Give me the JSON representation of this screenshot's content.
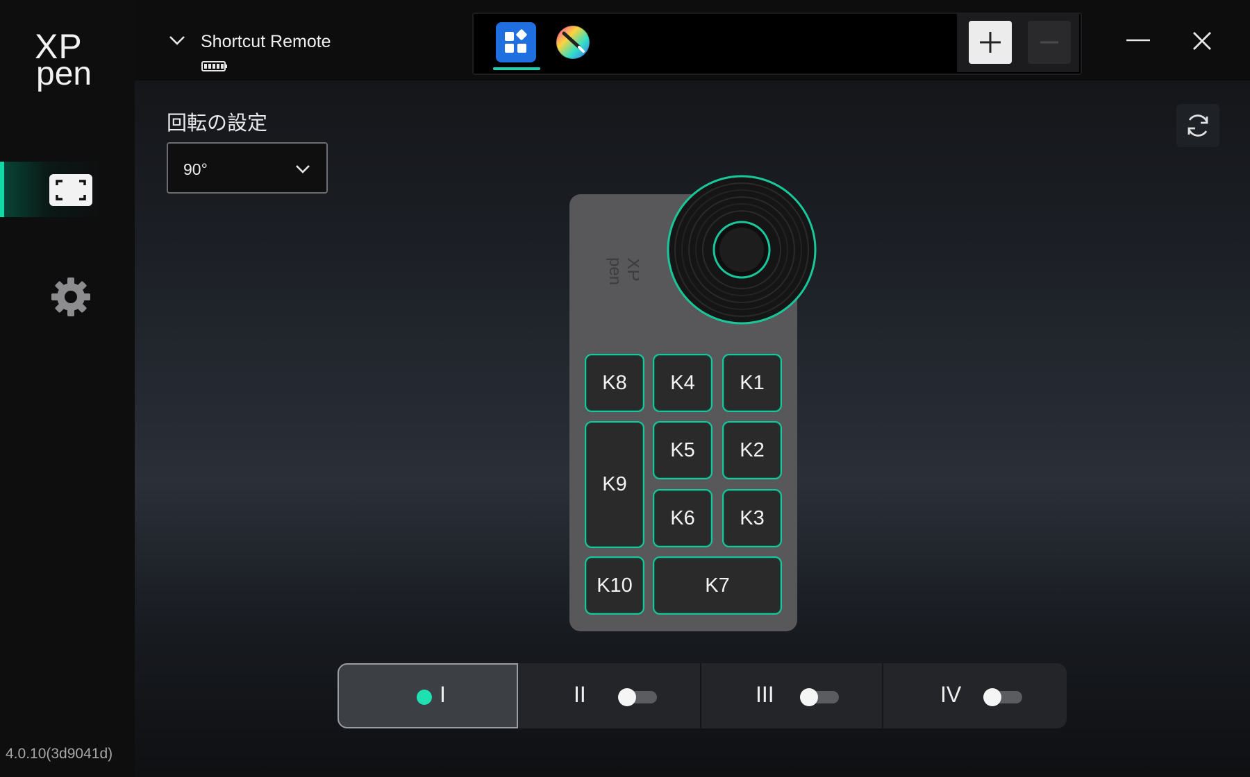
{
  "app": {
    "version": "4.0.10(3d9041d)"
  },
  "logo": {
    "line1": "XP",
    "line2": "pen"
  },
  "sidebar": {
    "items": [
      {
        "icon": "device-frame-icon",
        "active": true
      },
      {
        "icon": "gear-icon",
        "active": false
      }
    ]
  },
  "device": {
    "name": "Shortcut Remote",
    "battery_icon": "battery-icon"
  },
  "toolbar": {
    "tabs": [
      {
        "icon": "shortcut-keys-icon",
        "active": true
      },
      {
        "icon": "color-wheel-icon",
        "active": false
      }
    ],
    "add_icon": "plus-icon",
    "remove_icon": "minus-icon"
  },
  "rotation": {
    "label": "回転の設定",
    "value": "90°"
  },
  "remote": {
    "keys": [
      "K8",
      "K4",
      "K1",
      "K9",
      "K5",
      "K2",
      "K6",
      "K3",
      "K10",
      "K7"
    ]
  },
  "profiles": [
    {
      "label": "I",
      "active": true
    },
    {
      "label": "II",
      "active": false
    },
    {
      "label": "III",
      "active": false
    },
    {
      "label": "IV",
      "active": false
    }
  ],
  "colors": {
    "accent": "#13d8a6",
    "primary_button": "#1f6fe0"
  }
}
